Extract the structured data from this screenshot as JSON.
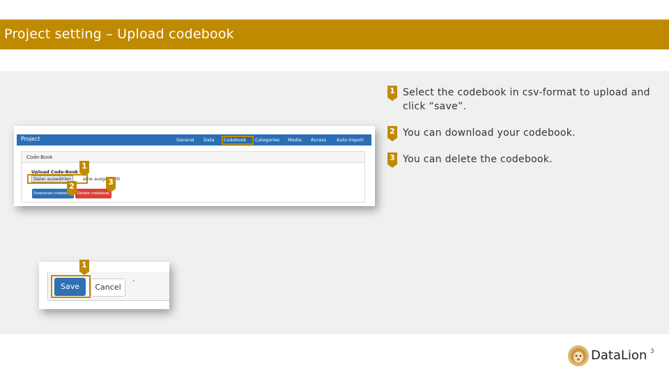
{
  "slide": {
    "title": "Project setting – Upload codebook",
    "page_number": "3",
    "logo_text": "DataLion"
  },
  "colors": {
    "title_bar": "#c08a00",
    "accent": "#c08a00",
    "nav_blue": "#2a6fb6",
    "delete_red": "#d9413a",
    "content_bg": "#f0f0f0"
  },
  "screenshot1": {
    "brand": "Project",
    "tabs": [
      "General",
      "Data",
      "Codebook",
      "Categories",
      "Media",
      "Access",
      "Auto Import"
    ],
    "active_tab": "Codebook",
    "panel_title": "Code-Book",
    "upload_label": "Upload Code-Book",
    "file_button": "Datei auswählen",
    "file_status": "eine ausgewählt",
    "download_button": "Download codebook",
    "delete_button": "Delete codebook"
  },
  "screenshot2": {
    "save_button": "Save",
    "cancel_button": "Cancel",
    "dot": "."
  },
  "badges": [
    "1",
    "2",
    "3"
  ],
  "steps": [
    {
      "num": "1",
      "text": "Select the codebook in csv-format to upload and click “save”."
    },
    {
      "num": "2",
      "text": "You can download your codebook."
    },
    {
      "num": "3",
      "text": "You can delete the codebook."
    }
  ]
}
